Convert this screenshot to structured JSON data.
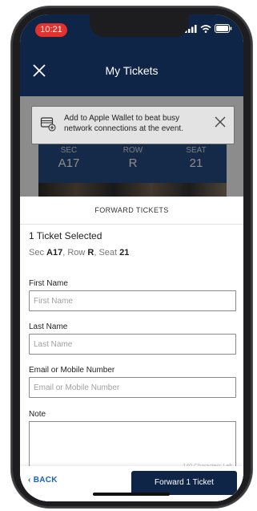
{
  "status": {
    "time": "10:21",
    "icons": [
      "signal-icon",
      "wifi-icon",
      "battery-icon"
    ]
  },
  "header": {
    "title": "My Tickets",
    "close_icon": "close-icon"
  },
  "ticket": {
    "sec_label": "SEC",
    "sec_value": "A17",
    "row_label": "ROW",
    "row_value": "R",
    "seat_label": "SEAT",
    "seat_value": "21"
  },
  "wallet_banner": {
    "text": "Add to Apple Wallet to beat busy network connections at the event."
  },
  "sheet": {
    "title": "FORWARD TICKETS",
    "selected": "1 Ticket Selected",
    "seat_sec_prefix": "Sec ",
    "seat_sec": "A17",
    "seat_row_prefix": ", Row ",
    "seat_row": "R",
    "seat_seat_prefix": ", Seat ",
    "seat_seat": "21"
  },
  "form": {
    "first_name_label": "First Name",
    "first_name_placeholder": "First Name",
    "last_name_label": "Last Name",
    "last_name_placeholder": "Last Name",
    "contact_label": "Email or Mobile Number",
    "contact_placeholder": "Email or Mobile Number",
    "note_label": "Note",
    "char_count": "140 Characters Left"
  },
  "footer": {
    "back_label": "BACK",
    "forward_label": "Forward 1 Ticket"
  },
  "colors": {
    "navy": "#0e2547",
    "link_blue": "#1565c0",
    "time_red": "#e1322d"
  }
}
